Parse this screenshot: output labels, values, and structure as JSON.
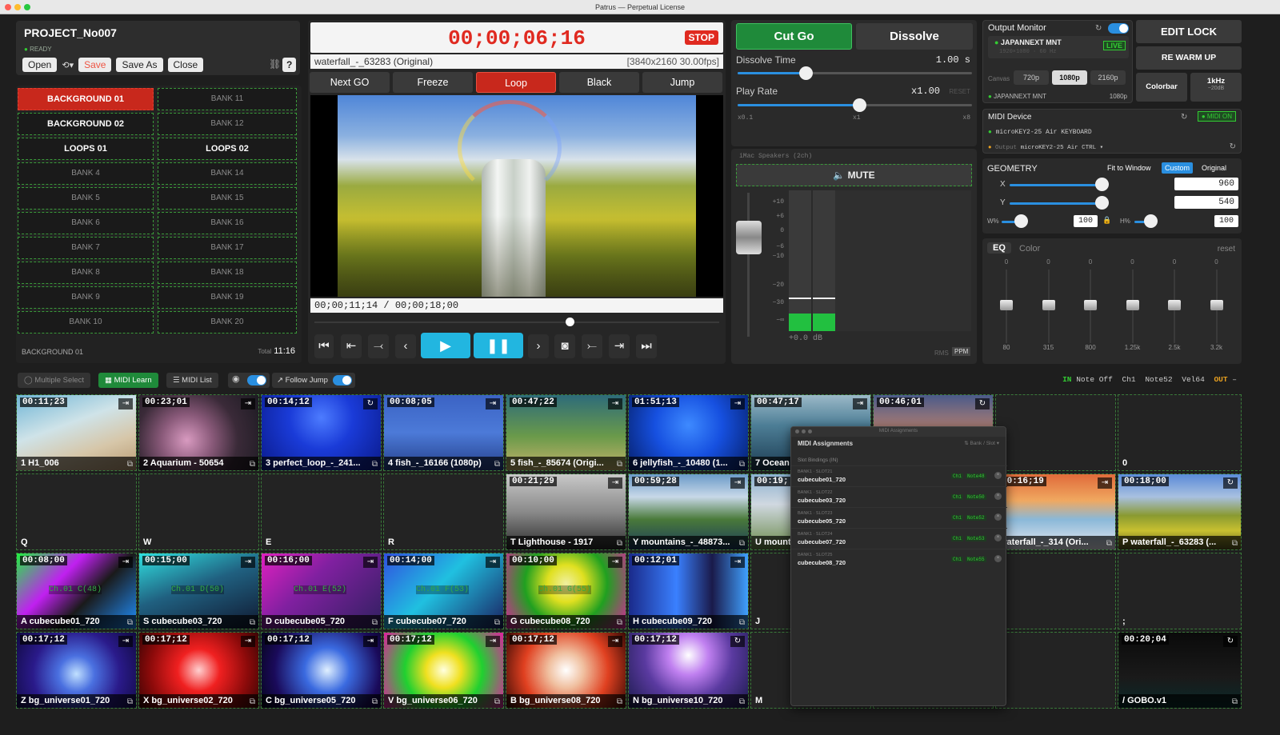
{
  "window": {
    "title": "Patrus — Perpetual License"
  },
  "project": {
    "name": "PROJECT_No007",
    "status": "READY",
    "buttons": {
      "open": "Open",
      "save": "Save",
      "save_as": "Save As",
      "close": "Close",
      "help": "?"
    }
  },
  "banks": {
    "left": [
      "BACKGROUND 01",
      "BACKGROUND 02",
      "LOOPS 01",
      "BANK 4",
      "BANK 5",
      "BANK 6",
      "BANK 7",
      "BANK 8",
      "BANK 9",
      "BANK 10"
    ],
    "right": [
      "BANK 11",
      "BANK 12",
      "LOOPS 02",
      "BANK 14",
      "BANK 15",
      "BANK 16",
      "BANK 17",
      "BANK 18",
      "BANK 19",
      "BANK 20"
    ],
    "current": "BACKGROUND 01",
    "total_label": "Total",
    "total": "11:16"
  },
  "player": {
    "timecode": "00;00;06;16",
    "stop": "STOP",
    "file": "waterfall_-_63283 (Original)",
    "format": "[3840x2160 30.00fps]",
    "transport": [
      "Next GO",
      "Freeze",
      "Loop",
      "Black",
      "Jump"
    ],
    "position": "00;00;11;14 / 00;00;18;00",
    "scrub_fraction": 0.63,
    "controls": {
      "first": "K",
      "prev": "‹",
      "next": "›",
      "last": "≻",
      "camera": "◙"
    }
  },
  "mix": {
    "cut_go": "Cut Go",
    "dissolve": "Dissolve",
    "dissolve_time_label": "Dissolve Time",
    "dissolve_time": "1.00 s",
    "dissolve_fraction": 0.29,
    "play_rate_label": "Play Rate",
    "play_rate": "x1.00",
    "reset": "RESET",
    "rate_min": "x0.1",
    "rate_mid": "x1",
    "rate_max": "x8",
    "play_rate_fraction": 0.52
  },
  "audio": {
    "device": "iMac Speakers (2ch)",
    "mute": "MUTE",
    "scale": [
      "+10",
      "+6",
      "0",
      "−6",
      "−10",
      "−20",
      "−30",
      "−∞"
    ],
    "db": "+0.0",
    "db_unit": "dB",
    "rms": "RMS",
    "ppm": "PPM"
  },
  "output": {
    "title": "Output Monitor",
    "display": "JAPANNEXT MNT",
    "display_sub": "1920×1080 · 60 Hz",
    "live": "LIVE",
    "canvas_label": "Canvas",
    "canvas_options": [
      "720p",
      "1080p",
      "2160p"
    ],
    "canvas_selected": "1080p",
    "foot_display": "JAPANNEXT MNT",
    "foot_res": "1080p"
  },
  "side_buttons": {
    "edit_lock": "EDIT LOCK",
    "rewarm": "RE WARM UP",
    "colorbar": "Colorbar",
    "tone": "1kHz",
    "tone_sub": "−20dB"
  },
  "midi": {
    "title": "MIDI Device",
    "on": "MIDI ON",
    "input": "microKEY2-25 Air KEYBOARD",
    "output_label": "Output",
    "output": "microKEY2-25 Air CTRL"
  },
  "geometry": {
    "title": "GEOMETRY",
    "modes": [
      "Fit to Window",
      "Custom",
      "Original"
    ],
    "mode_selected": "Custom",
    "x_label": "X",
    "x": "960",
    "y_label": "Y",
    "y": "540",
    "w_label": "W%",
    "w": "100",
    "h_label": "H%",
    "h": "100"
  },
  "eq": {
    "tab_eq": "EQ",
    "tab_color": "Color",
    "reset": "reset",
    "gains": [
      "0",
      "0",
      "0",
      "0",
      "0",
      "0"
    ],
    "bands": [
      "80",
      "315",
      "800",
      "1.25k",
      "2.5k",
      "3.2k"
    ]
  },
  "toolbar": {
    "multi_select": "Multiple Select",
    "midi_learn": "MIDI Learn",
    "midi_list": "MIDI List",
    "follow_jump": "Follow Jump"
  },
  "midi_status": {
    "in": "IN",
    "event": "Note Off",
    "channel": "Ch1",
    "note": "Note52",
    "velocity": "Vel64",
    "out": "OUT",
    "out_val": "–"
  },
  "midi_assign": {
    "title": "MIDI Assignments",
    "ghost_title": "MIDI Assignments",
    "header": "Slot Bindings (IN)",
    "filter": "Bank / Slot",
    "rows": [
      {
        "slot": "BANK1 · SLOT21",
        "name": "cubecube01_720",
        "ch": "Ch1",
        "note": "Note48"
      },
      {
        "slot": "BANK1 · SLOT22",
        "name": "cubecube03_720",
        "ch": "Ch1",
        "note": "Note50"
      },
      {
        "slot": "BANK1 · SLOT23",
        "name": "cubecube05_720",
        "ch": "Ch1",
        "note": "Note52"
      },
      {
        "slot": "BANK1 · SLOT24",
        "name": "cubecube07_720",
        "ch": "Ch1",
        "note": "Note53"
      },
      {
        "slot": "BANK1 · SLOT25",
        "name": "cubecube08_720",
        "ch": "Ch1",
        "note": "Note55"
      }
    ]
  },
  "grid": [
    {
      "tc": "00:11;23",
      "label": "1 H1_006",
      "mode": "⇥",
      "bg": "linear-gradient(160deg,#6fb5d6 0%,#cfe3e8 40%,#d6c6a8 70%,#b89a72 100%)"
    },
    {
      "tc": "00:23;01",
      "label": "2 Aquarium - 50654",
      "mode": "⇥",
      "bg": "radial-gradient(circle at 40% 60%,#d89ac0 0%,#8a5a7a 30%,#3a2a38 60%,#1c1a22 100%)"
    },
    {
      "tc": "00:14;12",
      "label": "3 perfect_loop_-_241...",
      "mode": "↻",
      "bg": "radial-gradient(circle at 50% 30%,#4d7cff 0%,#1a3bd8 40%,#0a1a8a 100%)"
    },
    {
      "tc": "00:08;05",
      "label": "4 fish_-_16166 (1080p)",
      "mode": "⇥",
      "bg": "linear-gradient(180deg,#3b63c4 0%,#4c7ad8 50%,#25408a 100%)"
    },
    {
      "tc": "00:47;22",
      "label": "5 fish_-_85674 (Origi...",
      "mode": "⇥",
      "bg": "linear-gradient(180deg,#2d6b7a 0%,#6a9a4a 55%,#c4b26a 100%)"
    },
    {
      "tc": "01:51;13",
      "label": "6 jellyfish_-_10480 (1...",
      "mode": "⇥",
      "bg": "radial-gradient(circle at 50% 40%,#3e8aff 0%,#1650e0 45%,#06206a 100%)"
    },
    {
      "tc": "00:47;17",
      "label": "7 Ocean",
      "mode": "⇥",
      "bg": "linear-gradient(180deg,#9bb9c8 0%,#4d7e96 40%,#1c3c52 100%)"
    },
    {
      "tc": "00:46;01",
      "label": "",
      "mode": "↻",
      "bg": "linear-gradient(180deg,#4a5a8a 0%,#d08a6a 60%,#e0b080 100%)"
    },
    {
      "tc": "",
      "label": "",
      "mode": "",
      "bg": ""
    },
    {
      "tc": "",
      "label": "",
      "mode": "",
      "bg": "",
      "key": "0"
    },
    {
      "tc": "",
      "label": "",
      "mode": "",
      "bg": "",
      "key": "Q"
    },
    {
      "tc": "",
      "label": "",
      "mode": "",
      "bg": "",
      "key": "W"
    },
    {
      "tc": "",
      "label": "",
      "mode": "",
      "bg": "",
      "key": "E"
    },
    {
      "tc": "",
      "label": "",
      "mode": "",
      "bg": "",
      "key": "R"
    },
    {
      "tc": "00:21;29",
      "label": "T Lighthouse - 1917",
      "mode": "⇥",
      "bg": "linear-gradient(180deg,#c8c8c8 0%,#8a8a8a 50%,#2a2a2a 100%)"
    },
    {
      "tc": "00:59;28",
      "label": "Y mountains_-_48873...",
      "mode": "⇥",
      "bg": "linear-gradient(180deg,#6a9ac8 0%,#c8d8e8 30%,#4a7a3a 60%,#1a3a5a 100%)"
    },
    {
      "tc": "00:19;",
      "label": "U mount",
      "mode": "",
      "bg": "linear-gradient(180deg,#8ab0d0 0%,#d0d8e0 40%,#6a8a4a 100%)"
    },
    {
      "tc": "",
      "label": "",
      "mode": "",
      "bg": ""
    },
    {
      "tc": "00:16;19",
      "label": "waterfall_-_314 (Ori...",
      "mode": "⇥",
      "bg": "linear-gradient(180deg,#e06a3a 0%,#f0a860 35%,#8ab8d8 60%,#e8e8f0 100%)"
    },
    {
      "tc": "00:18;00",
      "label": "P waterfall_-_63283 (...",
      "mode": "↻",
      "bg": "linear-gradient(180deg,#5a8ad8 0%,#a8c0e0 30%,#8a9a30 55%,#c8c030 75%,#5a5a20 100%)"
    },
    {
      "tc": "00:08;00",
      "label": "A cubecube01_720",
      "mode": "⇥",
      "bg": "linear-gradient(135deg,#20f040 0%,#c020f0 35%,#1a1a1a 60%,#2090ff 100%)",
      "midi": "Ch.01 C(48)"
    },
    {
      "tc": "00:15;00",
      "label": "S cubecube03_720",
      "mode": "⇥",
      "bg": "linear-gradient(160deg,#30e0e0 0%,#206080 45%,#101830 100%)",
      "midi": "Ch.01 D(50)"
    },
    {
      "tc": "00:16;00",
      "label": "D cubecube05_720",
      "mode": "⇥",
      "bg": "linear-gradient(135deg,#e020c0 0%,#8020a0 40%,#302060 100%)",
      "midi": "Ch.01 E(52)"
    },
    {
      "tc": "00:14;00",
      "label": "F cubecube07_720",
      "mode": "⇥",
      "bg": "linear-gradient(135deg,#3050e0 0%,#20c0e0 45%,#1a2060 100%)",
      "midi": "Ch.01 F(53)"
    },
    {
      "tc": "00:10;00",
      "label": "G cubecube08_720",
      "mode": "⇥",
      "bg": "radial-gradient(circle at 50% 40%,#f0f0a0 0%,#e0e020 25%,#20a020 55%,#e020a0 100%)",
      "midi": "Ch.01 G(55)"
    },
    {
      "tc": "00:12;01",
      "label": "H cubecube09_720",
      "mode": "⇥",
      "bg": "linear-gradient(90deg,#1a2a8a 0%,#3a80ff 40%,#1a1a4a 70%,#40a0ff 100%)"
    },
    {
      "tc": "",
      "label": "",
      "mode": "",
      "bg": "",
      "key": "J"
    },
    {
      "tc": "",
      "label": "",
      "mode": "",
      "bg": ""
    },
    {
      "tc": "",
      "label": "",
      "mode": "",
      "bg": ""
    },
    {
      "tc": "",
      "label": "",
      "mode": "",
      "bg": "",
      "key": ";"
    },
    {
      "tc": "00:17;12",
      "label": "Z bg_universe01_720",
      "mode": "⇥",
      "bg": "radial-gradient(circle at 50% 55%,#c0e0ff 0%,#4a70e0 25%,#2a1a8a 60%,#100a40 100%)"
    },
    {
      "tc": "00:17;12",
      "label": "X bg_universe02_720",
      "mode": "⇥",
      "bg": "radial-gradient(circle at 50% 50%,#ffd0d0 0%,#f02020 30%,#8a0a0a 70%,#3a0505 100%)"
    },
    {
      "tc": "00:17;12",
      "label": "C bg_universe05_720",
      "mode": "⇥",
      "bg": "radial-gradient(circle at 55% 50%,#e0f0ff 0%,#3a6ae0 30%,#1a0a5a 70%,#05051a 100%)"
    },
    {
      "tc": "00:17;12",
      "label": "V bg_universe06_720",
      "mode": "⇥",
      "bg": "radial-gradient(circle at 50% 50%,#ffffe0 0%,#f0e020 25%,#20d030 55%,#e020a0 100%)"
    },
    {
      "tc": "00:17;12",
      "label": "B bg_universe08_720",
      "mode": "⇥",
      "bg": "radial-gradient(circle at 50% 50%,#ffffff 0%,#f0c0a0 25%,#e04020 60%,#3a0a05 100%)"
    },
    {
      "tc": "00:17;12",
      "label": "N bg_universe10_720",
      "mode": "↻",
      "bg": "radial-gradient(circle at 50% 30%,#ffffff 0%,#c080f0 25%,#5a3aa0 55%,#1a1a4a 100%)"
    },
    {
      "tc": "",
      "label": "",
      "mode": "",
      "bg": "",
      "key": "M"
    },
    {
      "tc": "",
      "label": "",
      "mode": "",
      "bg": "",
      "key": ","
    },
    {
      "tc": "",
      "label": "",
      "mode": "",
      "bg": "",
      "key": "."
    },
    {
      "tc": "00:20;04",
      "label": "/ GOBO.v1",
      "mode": "↻",
      "bg": "linear-gradient(180deg,#0a0a0a 0%,#1a1a1a 60%,#0a2a2a 100%)"
    }
  ],
  "colors": {
    "accent": "#2a8fe0",
    "green": "#1f8a3a",
    "red": "#c8281c",
    "play": "#22b6e0"
  }
}
